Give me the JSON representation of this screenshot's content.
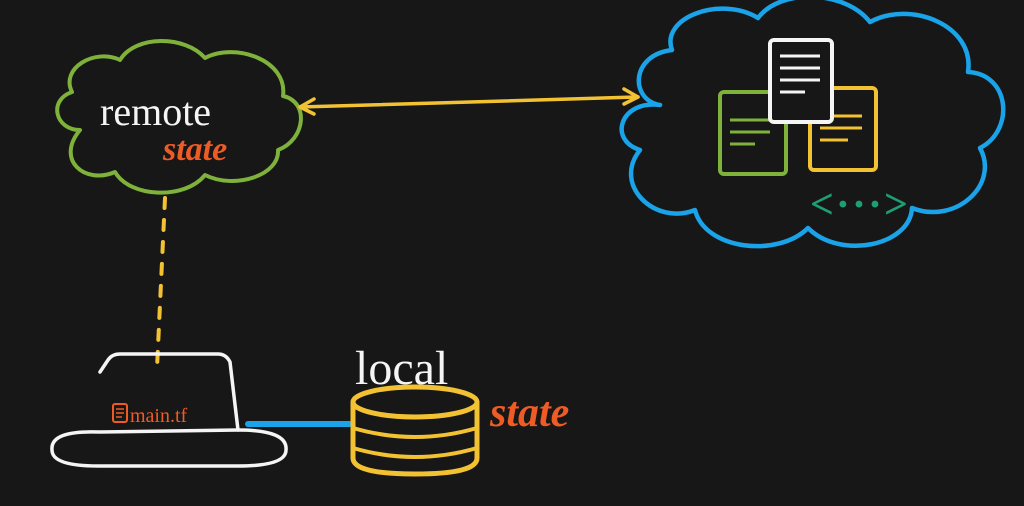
{
  "diagram": {
    "remote_cloud": {
      "line1": "remote",
      "line2": "state"
    },
    "local": {
      "line1": "local",
      "line2": "state",
      "file_label": "main.tf"
    },
    "resource_cloud": {
      "code_glyph": "<···>"
    },
    "colors": {
      "bg": "#171717",
      "white": "#f5f5f5",
      "green": "#7fb23b",
      "orange": "#ef5b25",
      "yellow": "#f3c233",
      "blue": "#1aa3e8",
      "teal": "#1d9e73"
    }
  }
}
